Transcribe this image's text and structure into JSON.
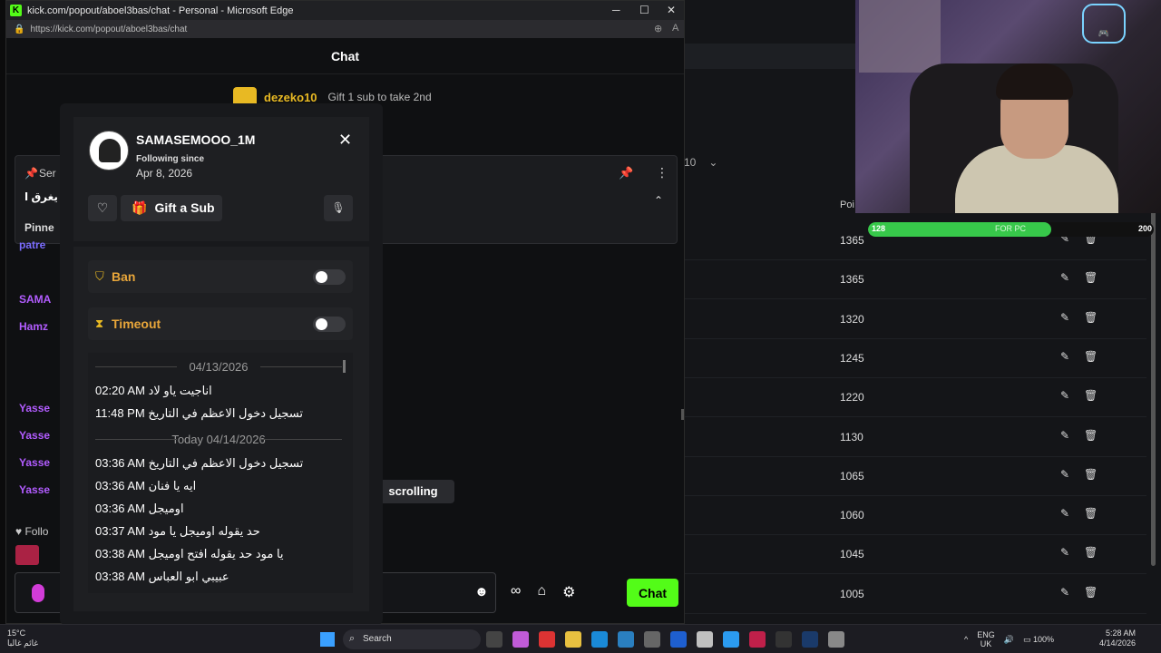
{
  "window": {
    "title": "kick.com/popout/aboel3bas/chat - Personal - Microsoft Edge",
    "url": "https://kick.com/popout/aboel3bas/chat",
    "header": "Chat"
  },
  "leaderboard": {
    "name": "dezeko10",
    "gift_text": "Gift 1 sub to take 2nd"
  },
  "pinned": {
    "sender": "Ser",
    "text": "يغرق ا",
    "label": "Pinne"
  },
  "chat_users": [
    "patre",
    "",
    "SAMA",
    "Hamz",
    "",
    "",
    "Yasse",
    "Yasse",
    "Yasse",
    "Yasse"
  ],
  "chat_user_colors": [
    "#7b6cff",
    "#ffffff",
    "#b25cff",
    "#b25cff",
    "#ffffff",
    "#ffffff",
    "#b25cff",
    "#b25cff",
    "#b25cff",
    "#b25cff"
  ],
  "follow_label": "Follo",
  "scrolling_label": "scrolling",
  "send_button": "Chat",
  "modal": {
    "username": "SAMASEMOOO_1M",
    "following_since_label": "Following since",
    "following_date": "Apr 8, 2026",
    "gift_label": "Gift a Sub",
    "ban_label": "Ban",
    "timeout_label": "Timeout",
    "log": [
      {
        "kind": "date",
        "text": "04/13/2026"
      },
      {
        "kind": "msg",
        "time": "02:20 AM",
        "text": "اناجيت ياو لاد"
      },
      {
        "kind": "msg",
        "time": "11:48 PM",
        "text": "تسجيل دخول الاعظم في التاريخ"
      },
      {
        "kind": "date",
        "text": "Today 04/14/2026"
      },
      {
        "kind": "msg",
        "time": "03:36 AM",
        "text": "تسجيل دخول الاعظم في التاريخ"
      },
      {
        "kind": "msg",
        "time": "03:36 AM",
        "text": "ايه يا فنان"
      },
      {
        "kind": "msg",
        "time": "03:36 AM",
        "text": "اوميجل"
      },
      {
        "kind": "msg",
        "time": "03:37 AM",
        "text": "حد يقوله اوميجل يا مود"
      },
      {
        "kind": "msg",
        "time": "03:38 AM",
        "text": "يا مود حد يقوله افتح اوميجل"
      },
      {
        "kind": "msg",
        "time": "03:38 AM",
        "text": "عبيبي ابو العباس"
      }
    ]
  },
  "background_app": {
    "dropdown_value": "10",
    "points_header": "Poi",
    "points": [
      "1365",
      "1365",
      "1320",
      "1245",
      "1220",
      "1130",
      "1065",
      "1060",
      "1045",
      "1005"
    ]
  },
  "goal": {
    "current": "128",
    "label": "FOR PC",
    "target": "200",
    "fill_fraction": 0.64,
    "color": "#37c84a"
  },
  "taskbar": {
    "weather_temp": "15°C",
    "weather_desc": "غائم غالبا",
    "search_placeholder": "Search",
    "lang": "ENG",
    "region": "UK",
    "battery": "100%",
    "time": "5:28 AM",
    "date": "4/14/2026"
  },
  "colors": {
    "kick_green": "#53fc18",
    "mod_gold": "#e8a63a"
  }
}
